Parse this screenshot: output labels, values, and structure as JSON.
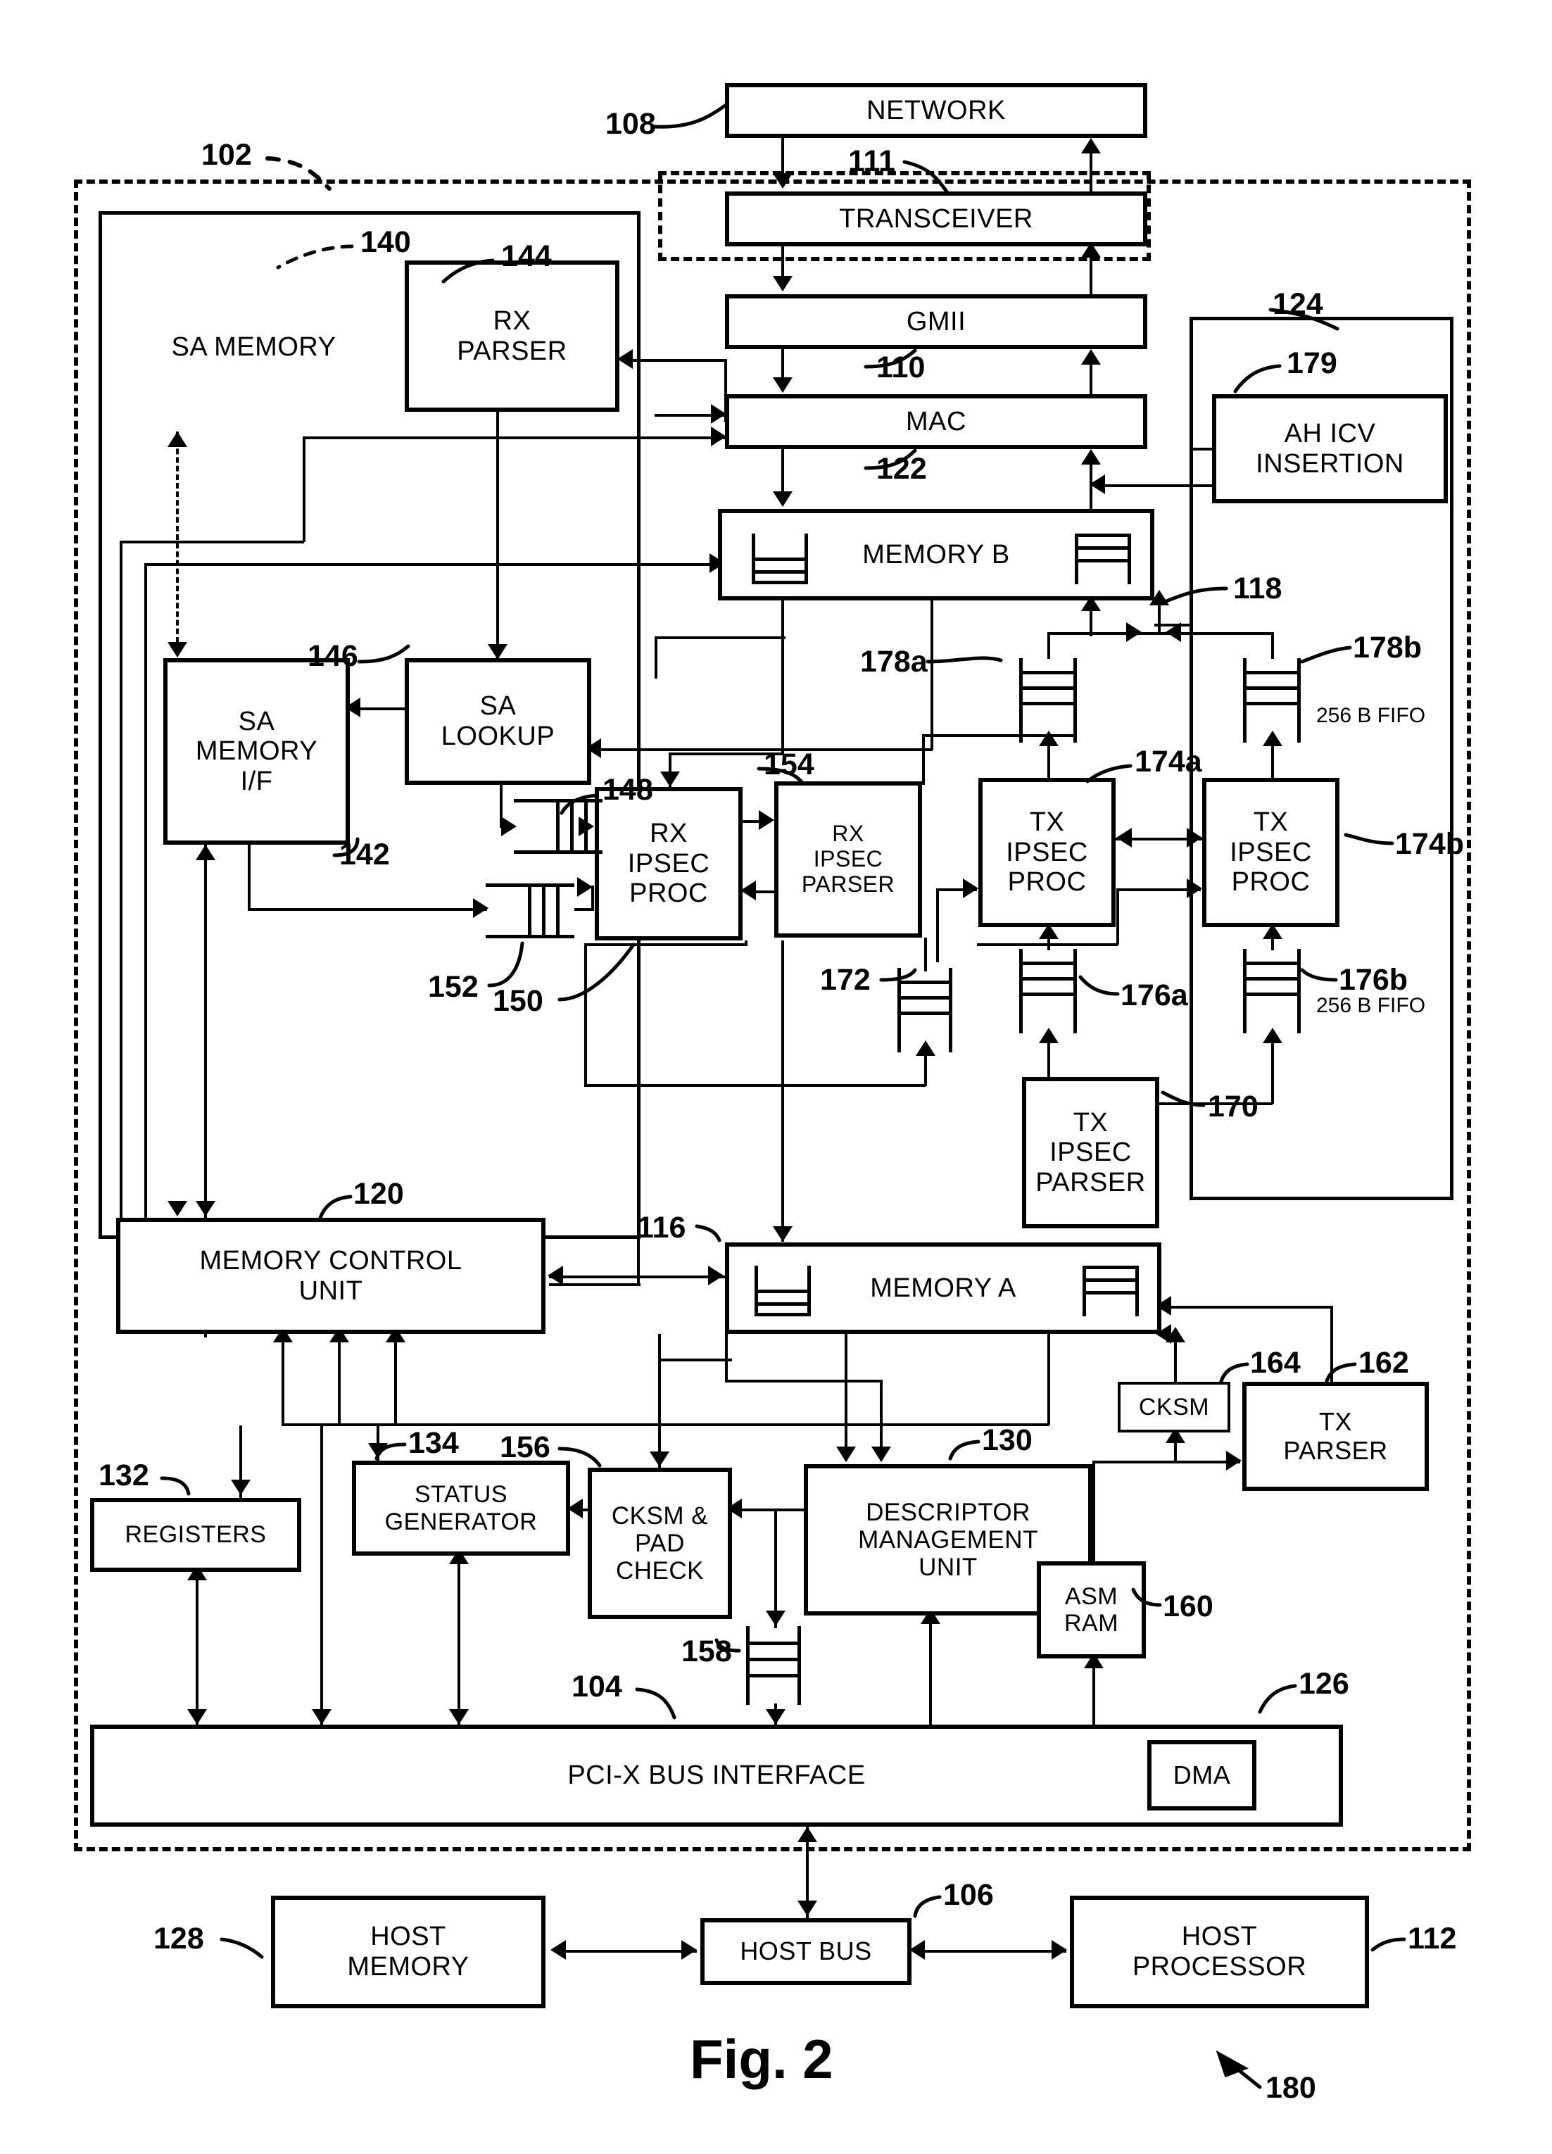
{
  "figure": {
    "label": "Fig. 2",
    "system_ref": "180"
  },
  "enclosures": {
    "nic_ref": "102",
    "sa_memory_ref": "140",
    "ipsec_group_ref": "124"
  },
  "blocks": [
    {
      "id": "network",
      "label": "NETWORK",
      "ref": "108"
    },
    {
      "id": "transceiver",
      "label": "TRANSCEIVER",
      "ref": "111"
    },
    {
      "id": "gmii",
      "label": "GMII",
      "ref": "110"
    },
    {
      "id": "mac",
      "label": "MAC",
      "ref": "122"
    },
    {
      "id": "memory_b",
      "label": "MEMORY B",
      "ref": "118"
    },
    {
      "id": "sa_memory",
      "label": "SA MEMORY",
      "ref": "140"
    },
    {
      "id": "rx_parser",
      "label": "RX\nPARSER",
      "ref": "144"
    },
    {
      "id": "ah_icv",
      "label": "AH ICV\nINSERTION",
      "ref": "179"
    },
    {
      "id": "sa_memory_if",
      "label": "SA\nMEMORY\nI/F",
      "ref": "142"
    },
    {
      "id": "sa_lookup",
      "label": "SA\nLOOKUP",
      "ref": "146"
    },
    {
      "id": "rx_ipsec_proc",
      "label": "RX\nIPSEC\nPROC",
      "ref": "150"
    },
    {
      "id": "rx_ipsec_parser",
      "label": "RX\nIPSEC\nPARSER",
      "ref": "154"
    },
    {
      "id": "tx_ipsec_proc_a",
      "label": "TX\nIPSEC\nPROC",
      "ref": "174a"
    },
    {
      "id": "tx_ipsec_proc_b",
      "label": "TX\nIPSEC\nPROC",
      "ref": "174b"
    },
    {
      "id": "tx_ipsec_parser",
      "label": "TX\nIPSEC\nPARSER",
      "ref": "170"
    },
    {
      "id": "memory_control",
      "label": "MEMORY CONTROL\nUNIT",
      "ref": "120"
    },
    {
      "id": "memory_a",
      "label": "MEMORY A",
      "ref": "116"
    },
    {
      "id": "registers",
      "label": "REGISTERS",
      "ref": "132"
    },
    {
      "id": "status_gen",
      "label": "STATUS\nGENERATOR",
      "ref": "134"
    },
    {
      "id": "cksm_pad",
      "label": "CKSM &\nPAD\nCHECK",
      "ref": "156"
    },
    {
      "id": "descriptor_mgmt",
      "label": "DESCRIPTOR\nMANAGEMENT\nUNIT",
      "ref": "130"
    },
    {
      "id": "cksm",
      "label": "CKSM",
      "ref": "164"
    },
    {
      "id": "tx_parser",
      "label": "TX\nPARSER",
      "ref": "162"
    },
    {
      "id": "asm_ram",
      "label": "ASM\nRAM",
      "ref": "160"
    },
    {
      "id": "pcix",
      "label": "PCI-X BUS INTERFACE",
      "ref": "104"
    },
    {
      "id": "dma",
      "label": "DMA",
      "ref": "126"
    },
    {
      "id": "host_memory",
      "label": "HOST\nMEMORY",
      "ref": "128"
    },
    {
      "id": "host_bus",
      "label": "HOST BUS",
      "ref": "106"
    },
    {
      "id": "host_processor",
      "label": "HOST\nPROCESSOR",
      "ref": "112"
    }
  ],
  "fifos": [
    {
      "id": "fifo_148",
      "ref": "148",
      "note": ""
    },
    {
      "id": "fifo_152",
      "ref": "152",
      "note": ""
    },
    {
      "id": "fifo_172",
      "ref": "172",
      "note": ""
    },
    {
      "id": "fifo_158",
      "ref": "158",
      "note": ""
    },
    {
      "id": "fifo_178a",
      "ref": "178a",
      "note": ""
    },
    {
      "id": "fifo_178b",
      "ref": "178b",
      "note": "256 B FIFO"
    },
    {
      "id": "fifo_176a",
      "ref": "176a",
      "note": ""
    },
    {
      "id": "fifo_176b",
      "ref": "176b",
      "note": "256 B FIFO"
    }
  ],
  "refs": {
    "r102": "102",
    "r104": "104",
    "r106": "106",
    "r108": "108",
    "r110": "110",
    "r111": "111",
    "r112": "112",
    "r116": "116",
    "r118": "118",
    "r120": "120",
    "r122": "122",
    "r124": "124",
    "r126": "126",
    "r128": "128",
    "r130": "130",
    "r132": "132",
    "r134": "134",
    "r140": "140",
    "r142": "142",
    "r144": "144",
    "r146": "146",
    "r148": "148",
    "r150": "150",
    "r152": "152",
    "r154": "154",
    "r156": "156",
    "r158": "158",
    "r160": "160",
    "r162": "162",
    "r164": "164",
    "r170": "170",
    "r172": "172",
    "r174a": "174a",
    "r174b": "174b",
    "r176a": "176a",
    "r176b": "176b",
    "r178a": "178a",
    "r178b": "178b",
    "r179": "179",
    "r180": "180"
  },
  "labels": {
    "network": "NETWORK",
    "transceiver": "TRANSCEIVER",
    "gmii": "GMII",
    "mac": "MAC",
    "memory_b": "MEMORY B",
    "sa_memory": "SA MEMORY",
    "rx_parser_l1": "RX",
    "rx_parser_l2": "PARSER",
    "ah_icv_l1": "AH ICV",
    "ah_icv_l2": "INSERTION",
    "sa_mem_if_l1": "SA",
    "sa_mem_if_l2": "MEMORY",
    "sa_mem_if_l3": "I/F",
    "sa_lookup_l1": "SA",
    "sa_lookup_l2": "LOOKUP",
    "rx_ipsec_proc_l1": "RX",
    "rx_ipsec_proc_l2": "IPSEC",
    "rx_ipsec_proc_l3": "PROC",
    "rx_ipsec_parser_l1": "RX",
    "rx_ipsec_parser_l2": "IPSEC",
    "rx_ipsec_parser_l3": "PARSER",
    "tx_ipsec_proc_l1": "TX",
    "tx_ipsec_proc_l2": "IPSEC",
    "tx_ipsec_proc_l3": "PROC",
    "tx_ipsec_parser_l1": "TX",
    "tx_ipsec_parser_l2": "IPSEC",
    "tx_ipsec_parser_l3": "PARSER",
    "memory_control_l1": "MEMORY CONTROL",
    "memory_control_l2": "UNIT",
    "memory_a": "MEMORY A",
    "registers": "REGISTERS",
    "status_gen_l1": "STATUS",
    "status_gen_l2": "GENERATOR",
    "cksm_pad_l1": "CKSM &",
    "cksm_pad_l2": "PAD",
    "cksm_pad_l3": "CHECK",
    "descriptor_l1": "DESCRIPTOR",
    "descriptor_l2": "MANAGEMENT",
    "descriptor_l3": "UNIT",
    "cksm": "CKSM",
    "tx_parser_l1": "TX",
    "tx_parser_l2": "PARSER",
    "asm_ram_l1": "ASM",
    "asm_ram_l2": "RAM",
    "pcix": "PCI-X BUS INTERFACE",
    "dma": "DMA",
    "host_memory_l1": "HOST",
    "host_memory_l2": "MEMORY",
    "host_bus": "HOST BUS",
    "host_proc_l1": "HOST",
    "host_proc_l2": "PROCESSOR",
    "fifo_note_a": "256 B FIFO",
    "fifo_note_b": "256 B FIFO",
    "fig": "Fig. 2"
  }
}
